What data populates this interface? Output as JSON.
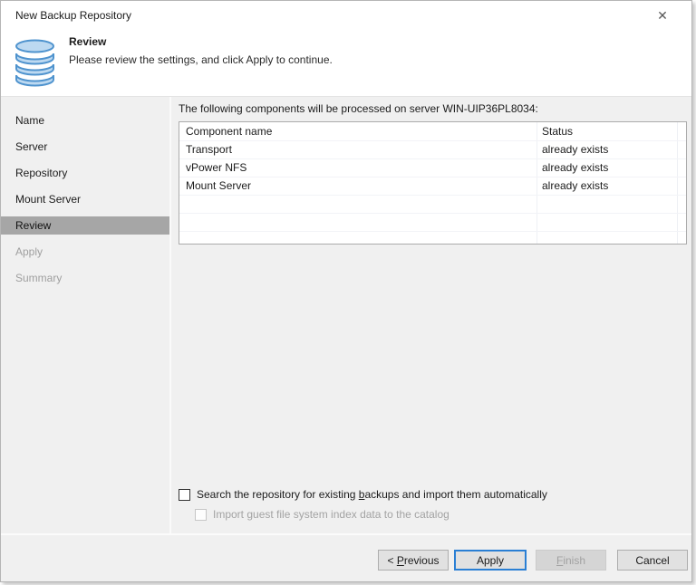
{
  "window": {
    "title": "New Backup Repository"
  },
  "icons": {
    "close": "✕",
    "logo": "database-stack"
  },
  "header": {
    "title": "Review",
    "subtitle": "Please review the settings, and click Apply to continue."
  },
  "sidebar": {
    "items": [
      {
        "label": "Name",
        "state": "enabled"
      },
      {
        "label": "Server",
        "state": "enabled"
      },
      {
        "label": "Repository",
        "state": "enabled"
      },
      {
        "label": "Mount Server",
        "state": "enabled"
      },
      {
        "label": "Review",
        "state": "current"
      },
      {
        "label": "Apply",
        "state": "disabled"
      },
      {
        "label": "Summary",
        "state": "disabled"
      }
    ]
  },
  "main": {
    "intro": "The following components will be processed on server WIN-UIP36PL8034:",
    "table": {
      "columns": {
        "name": "Component name",
        "status": "Status"
      },
      "rows": [
        {
          "name": "Transport",
          "status": "already exists"
        },
        {
          "name": "vPower NFS",
          "status": "already exists"
        },
        {
          "name": "Mount Server",
          "status": "already exists"
        }
      ]
    },
    "checkboxes": {
      "search": {
        "pre": "Search the repository for existing ",
        "key": "b",
        "post": "ackups and import them automatically",
        "checked": false,
        "enabled": true
      },
      "import_index": {
        "pre": "Import ",
        "key": "g",
        "post": "uest file system index data to the catalog",
        "checked": false,
        "enabled": false
      }
    }
  },
  "footer": {
    "previous": {
      "pre": "< ",
      "key": "P",
      "post": "revious"
    },
    "apply": {
      "label": "Apply"
    },
    "finish": {
      "pre": "",
      "key": "F",
      "post": "inish"
    },
    "cancel": {
      "label": "Cancel"
    }
  },
  "colors": {
    "accent": "#2a7fd4",
    "selected_step_bg": "#a6a6a6",
    "body_bg": "#f0f0f0",
    "icon_fill": "#bdd9f1",
    "icon_stroke": "#4f93ce"
  }
}
